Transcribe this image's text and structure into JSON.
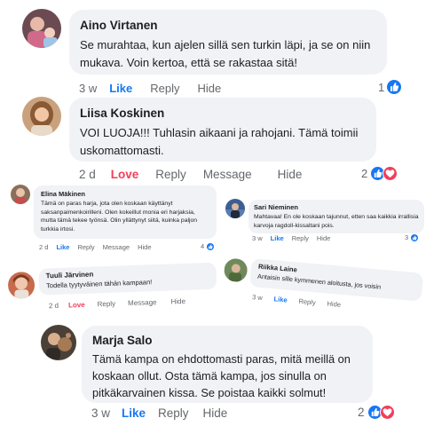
{
  "labels": {
    "like": "Like",
    "love": "Love",
    "reply": "Reply",
    "message": "Message",
    "hide": "Hide"
  },
  "colors": {
    "bubble": "#f0f2f5",
    "like_blue": "#1877f2",
    "love_red": "#f33e58",
    "meta_gray": "#65676b"
  },
  "comments": [
    {
      "author": "Aino Virtanen",
      "text": "Se murahtaa, kun ajelen sillä sen turkin läpi, ja se on niin mukava. Voin kertoa, että se rakastaa sitä!",
      "time": "3 w",
      "reaction_count": "1",
      "reactions": [
        "like-icon"
      ]
    },
    {
      "author": "Liisa Koskinen",
      "text": "VOI LUOJA!!! Tuhlasin aikaani ja rahojani. Tämä toimii uskomattomasti.",
      "time": "2 d",
      "reaction_count": "2",
      "reactions": [
        "like-icon",
        "love-icon"
      ]
    },
    {
      "author": "Elina Mäkinen",
      "text": "Tämä on paras harja, jota olen koskaan käyttänyt saksanpaimenkoirilleni. Olen kokeillut monia eri harjaksia, mutta tämä tekee työnsä. Olin yllättynyt siitä, kuinka paljon turkkia irtosi.",
      "time": "2 d",
      "reaction_count": "4",
      "reactions": [
        "like-icon"
      ]
    },
    {
      "author": "Sari Nieminen",
      "text": "Mahtavaa! En ole koskaan tajunnut, etten saa kaikkia irrallisia karvoja ragdoll-kissaltani pois.",
      "time": "3 w",
      "reaction_count": "3",
      "reactions": [
        "like-icon"
      ]
    },
    {
      "author": "Tuuli Järvinen",
      "text": "Todella tyytyväinen tähän kampaan!",
      "time": "2 d",
      "reaction_count": "",
      "reactions": []
    },
    {
      "author": "Riikka Laine",
      "text": "Antaisin sille kymmenen aloitusta, jos voisin",
      "time": "3 w",
      "reaction_count": "",
      "reactions": []
    },
    {
      "author": "Marja Salo",
      "text": "Tämä kampa on ehdottomasti paras, mitä meillä on koskaan ollut. Osta tämä kampa, jos sinulla on pitkäkarvainen kissa. Se poistaa kaikki solmut!",
      "time": "3 w",
      "reaction_count": "2",
      "reactions": [
        "like-icon",
        "love-icon"
      ]
    }
  ]
}
